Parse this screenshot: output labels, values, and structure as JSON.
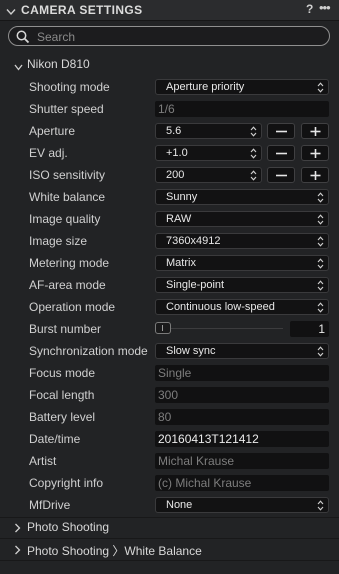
{
  "panel": {
    "title": "CAMERA SETTINGS",
    "help": "?",
    "more": "•••"
  },
  "search": {
    "placeholder": "Search"
  },
  "group": {
    "label": "Nikon D810",
    "settings": {
      "shooting_mode": {
        "label": "Shooting mode",
        "value": "Aperture priority"
      },
      "shutter_speed": {
        "label": "Shutter speed",
        "value": "1/6"
      },
      "aperture": {
        "label": "Aperture",
        "value": "5.6"
      },
      "ev_adj": {
        "label": "EV adj.",
        "value": "+1.0"
      },
      "iso": {
        "label": "ISO sensitivity",
        "value": "200"
      },
      "white_balance": {
        "label": "White balance",
        "value": "Sunny"
      },
      "image_quality": {
        "label": "Image quality",
        "value": "RAW"
      },
      "image_size": {
        "label": "Image size",
        "value": "7360x4912"
      },
      "metering_mode": {
        "label": "Metering mode",
        "value": "Matrix"
      },
      "af_area_mode": {
        "label": "AF-area mode",
        "value": "Single-point"
      },
      "operation_mode": {
        "label": "Operation mode",
        "value": "Continuous low-speed"
      },
      "burst_number": {
        "label": "Burst number",
        "value": "1",
        "level": 0
      },
      "sync_mode": {
        "label": "Synchronization mode",
        "value": "Slow sync"
      },
      "focus_mode": {
        "label": "Focus mode",
        "value": "Single"
      },
      "focal_length": {
        "label": "Focal length",
        "value": "300"
      },
      "battery_level": {
        "label": "Battery level",
        "value": "80"
      },
      "datetime": {
        "label": "Date/time",
        "value": "20160413T121412"
      },
      "artist": {
        "label": "Artist",
        "value": "Michal Krause"
      },
      "copyright": {
        "label": "Copyright info",
        "value": "(c) Michal Krause"
      },
      "mfdrive": {
        "label": "MfDrive",
        "value": "None"
      }
    }
  },
  "collapsed_groups": {
    "photo_shooting": "Photo Shooting",
    "photo_shooting_wb": "Photo Shooting 〉White Balance"
  },
  "colors": {
    "background": "#222325",
    "field": "#111112",
    "text": "#d0d0d0"
  }
}
